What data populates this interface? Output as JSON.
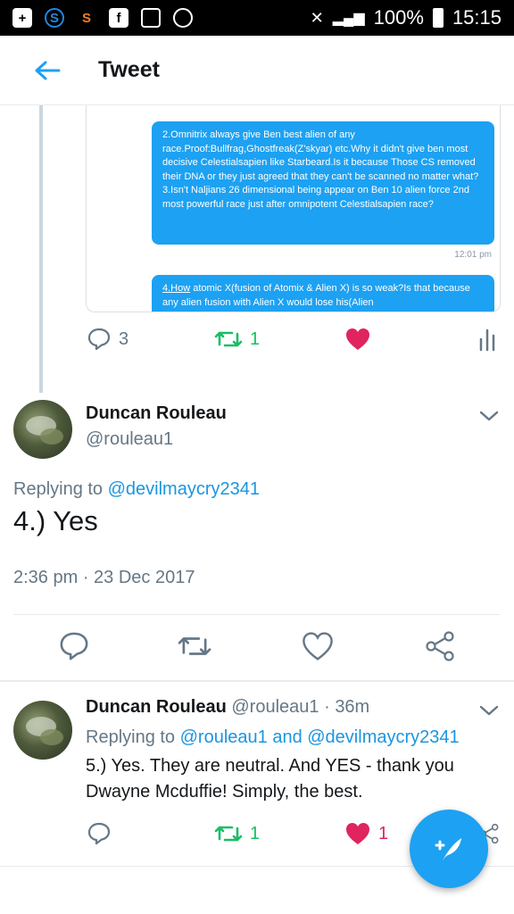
{
  "status_bar": {
    "battery": "100%",
    "time": "15:15"
  },
  "app_bar": {
    "title": "Tweet"
  },
  "parent_tweet": {
    "image_bubble_1": "2.Omnitrix always give Ben best alien of any race.Proof:Bullfrag,Ghostfreak(Z'skyar) etc.Why it didn't give ben most decisive Celestialsapien like Starbeard.Is it because Those CS removed their DNA or they just agreed that they can't be scanned no matter what?\n3.Isn't Naljians 26 dimensional being appear on Ben 10 alien force 2nd most powerful race just after omnipotent Celestialsapien race?",
    "image_time": "12:01 pm",
    "image_bubble_2_link": "4.How",
    "image_bubble_2": " atomic X(fusion of Atomix & Alien X) is so weak?Is that because any alien fusion with Alien X would lose his(Alien",
    "reply_count": "3",
    "retweet_count": "1"
  },
  "focus_tweet": {
    "name": "Duncan Rouleau",
    "handle": "@rouleau1",
    "replying_prefix": "Replying to ",
    "replying_to": "@devilmaycry2341",
    "text": "4.) Yes",
    "time": "2:36 pm",
    "date": "23 Dec 2017",
    "date_sep": " · "
  },
  "reply_tweet": {
    "name": "Duncan Rouleau",
    "handle": "@rouleau1",
    "age": "36m",
    "age_sep": "·",
    "replying_prefix": "Replying to ",
    "replying_to": "@rouleau1 and @devilmaycry2341",
    "text": "5.) Yes. They are neutral. And YES - thank you Dwayne Mcduffie! Simply, the best.",
    "retweet_count": "1",
    "like_count": "1"
  },
  "colors": {
    "accent": "#1da1f2",
    "retweet": "#17bf63",
    "like": "#e0245e",
    "muted": "#657786"
  },
  "icons": [
    "back-arrow-icon",
    "reply-icon",
    "retweet-icon",
    "like-icon",
    "analytics-icon",
    "share-icon",
    "chevron-down-icon",
    "compose-tweet-icon"
  ]
}
